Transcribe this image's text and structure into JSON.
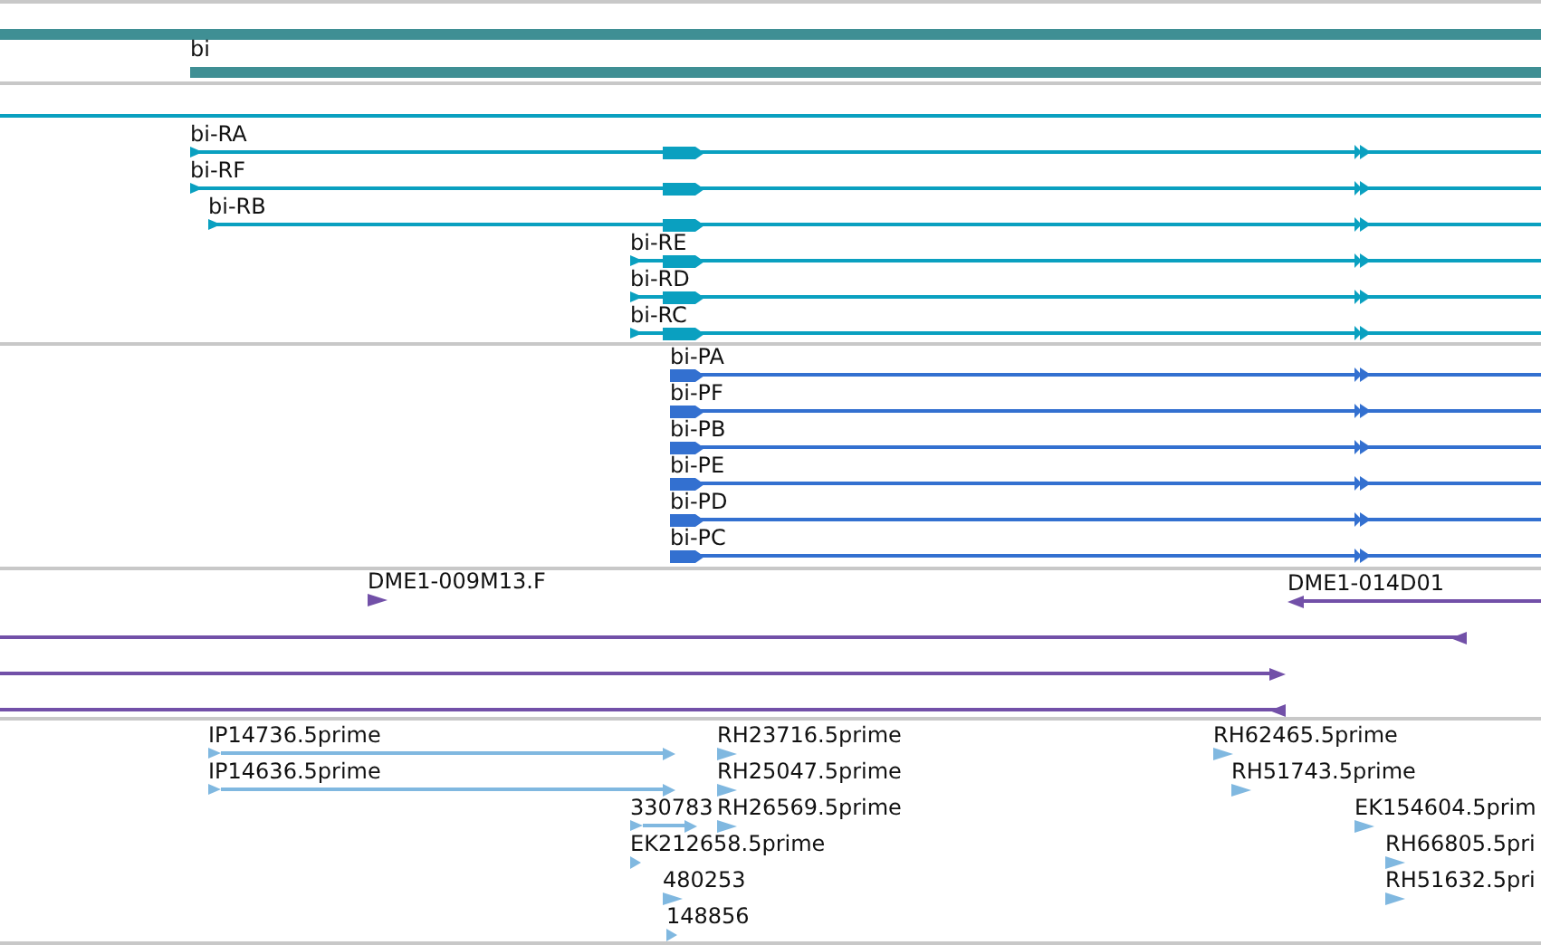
{
  "tracks": [
    {
      "kind": "gene",
      "features": [
        {
          "label": "bi"
        }
      ]
    },
    {
      "kind": "transcript",
      "features": [
        {
          "label": "bi-RA"
        },
        {
          "label": "bi-RF"
        },
        {
          "label": "bi-RB"
        },
        {
          "label": "bi-RE"
        },
        {
          "label": "bi-RD"
        },
        {
          "label": "bi-RC"
        }
      ]
    },
    {
      "kind": "protein",
      "features": [
        {
          "label": "bi-PA"
        },
        {
          "label": "bi-PF"
        },
        {
          "label": "bi-PB"
        },
        {
          "label": "bi-PE"
        },
        {
          "label": "bi-PD"
        },
        {
          "label": "bi-PC"
        }
      ]
    },
    {
      "kind": "clone",
      "features": [
        {
          "label": "DME1-009M13.F"
        },
        {
          "label": "DME1-014D01"
        }
      ]
    },
    {
      "kind": "est",
      "features": [
        {
          "label": "IP14736.5prime"
        },
        {
          "label": "IP14636.5prime"
        },
        {
          "label": "330783"
        },
        {
          "label": "RH23716.5prime"
        },
        {
          "label": "RH25047.5prime"
        },
        {
          "label": "RH26569.5prime"
        },
        {
          "label": "EK212658.5prime"
        },
        {
          "label": "480253"
        },
        {
          "label": "148856"
        },
        {
          "label": "RH62465.5prime"
        },
        {
          "label": "RH51743.5prime"
        },
        {
          "label": "EK154604.5prim"
        },
        {
          "label": "RH66805.5pri"
        },
        {
          "label": "RH51632.5pri"
        }
      ]
    }
  ]
}
